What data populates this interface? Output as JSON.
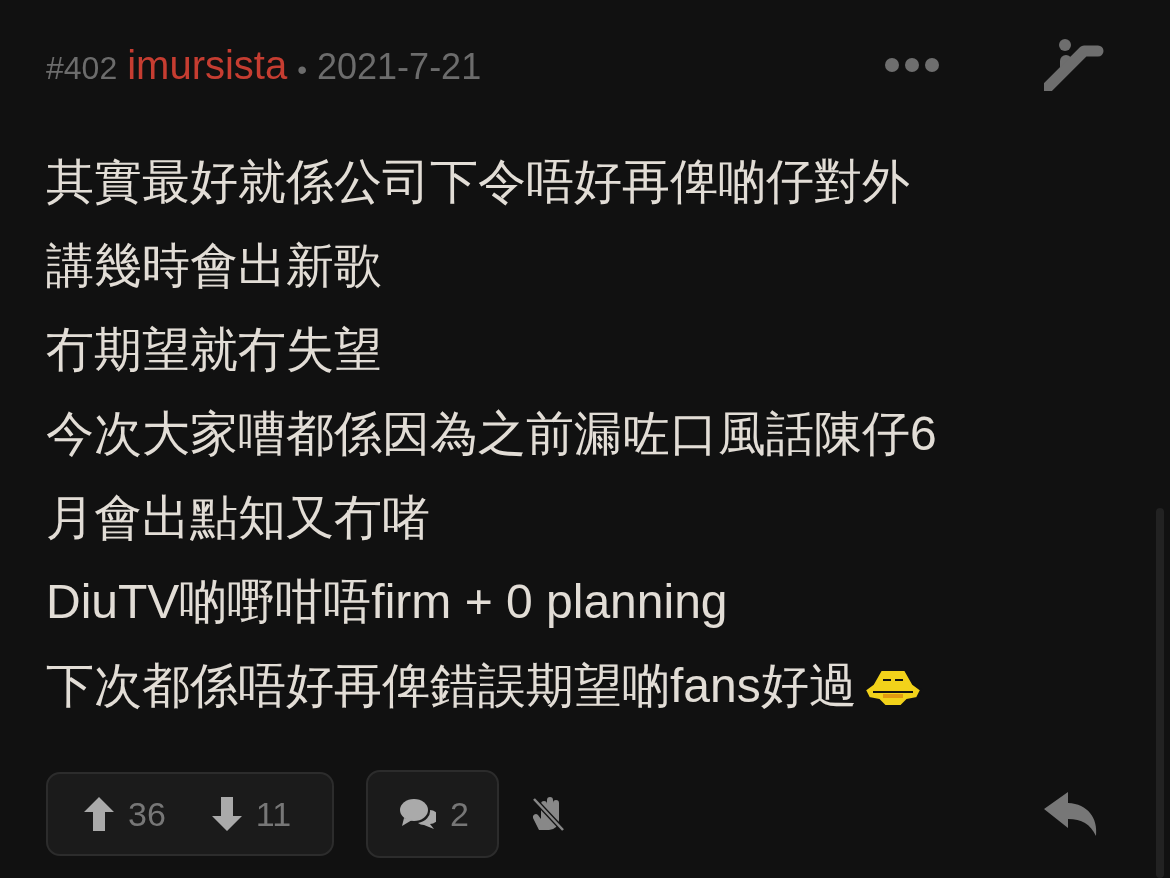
{
  "post": {
    "number": "#402",
    "author": "imursista",
    "separator": "•",
    "date": "2021-7-21",
    "lines": [
      "其實最好就係公司下令唔好再俾啲仔對外",
      "講幾時會出新歌",
      "冇期望就冇失望",
      "今次大家嘈都係因為之前漏咗口風話陳仔6",
      "月會出點知又冇啫",
      "DiuTV啲嘢咁唔firm + 0 planning",
      "下次都係唔好再俾錯誤期望啲fans好過"
    ],
    "ends_with_emoji": true
  },
  "actions": {
    "upvotes": "36",
    "downvotes": "11",
    "comments": "2"
  }
}
